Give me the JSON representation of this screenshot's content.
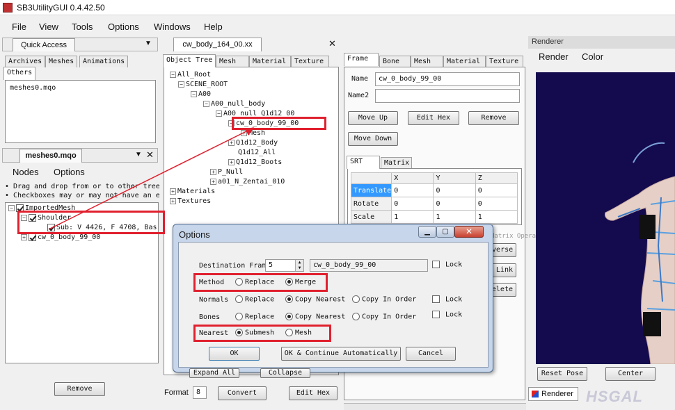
{
  "title_bar": {
    "title": "SB3UtilityGUI 0.4.42.50"
  },
  "menu": [
    "File",
    "View",
    "Tools",
    "Options",
    "Windows",
    "Help"
  ],
  "quick_access": {
    "title": "Quick Access",
    "tabs": [
      "Archives",
      "Meshes",
      "Animations",
      "Others"
    ],
    "items": [
      "meshes0.mqo"
    ]
  },
  "mqo_panel": {
    "title": "meshes0.mqo",
    "menu": [
      "Nodes",
      "Options"
    ],
    "hint1": "• Drag and drop from or to other tree",
    "hint2": "• Checkboxes may or may not have an e",
    "tree": [
      "ImportedMesh",
      "Shoulder",
      "Sub: V 4426, F 4708, Bas",
      "cw_0_body_99_00"
    ],
    "remove_label": "Remove"
  },
  "doc_tab": {
    "label": "cw_body_164_00.xx"
  },
  "object_tree": {
    "tabs": [
      "Object Tree",
      "Mesh",
      "Material",
      "Texture"
    ],
    "nodes": [
      "All_Root",
      "SCENE_ROOT",
      "A00",
      "A00_null_body",
      "A00_null_Q1d12_00",
      "cw_0_body_99_00",
      "Mesh",
      "Q1d12_Body",
      "Q1d12_All",
      "Q1d12_Boots",
      "P_Null",
      "a01_N_Zentai_010",
      "Materials",
      "Textures"
    ],
    "format_label": "Format",
    "format_value": "8",
    "convert_label": "Convert",
    "edit_hex_label": "Edit Hex",
    "hidden_btn1": "Expand All",
    "hidden_btn2": "Collapse"
  },
  "frame_panel": {
    "tabs": [
      "Frame",
      "Bone",
      "Mesh",
      "Material",
      "Texture"
    ],
    "name_label": "Name",
    "name_value": "cw_0_body_99_00",
    "name2_label": "Name2",
    "name2_value": "",
    "move_up": "Move Up",
    "edit_hex": "Edit Hex",
    "remove": "Remove",
    "move_down": "Move Down",
    "srt_tabs": [
      "SRT",
      "Matrix"
    ],
    "grid_headers": [
      "",
      "X",
      "Y",
      "Z"
    ],
    "grid_rows": [
      {
        "label": "Translate",
        "x": "0",
        "y": "0",
        "z": "0"
      },
      {
        "label": "Rotate",
        "x": "0",
        "y": "0",
        "z": "0"
      },
      {
        "label": "Scale",
        "x": "1",
        "y": "1",
        "z": "1"
      }
    ],
    "hidden_label": "Matrix Operations",
    "btn_reverse": "Reverse",
    "btn_link": "Link",
    "btn_delete": "Delete"
  },
  "renderer": {
    "title": "Renderer",
    "menu": [
      "Render",
      "Color"
    ],
    "reset_pose": "Reset Pose",
    "center": "Center",
    "tab_label": "Renderer",
    "watermark": "HSGAL"
  },
  "options_dialog": {
    "title": "Options",
    "dest_label": "Destination Fram",
    "dest_value": "5",
    "dest_name": "cw_0_body_99_00",
    "lock": "Lock",
    "method_label": "Method",
    "replace": "Replace",
    "merge": "Merge",
    "normals_label": "Normals",
    "copy_nearest": "Copy Nearest",
    "copy_in_order": "Copy In Order",
    "bones_label": "Bones",
    "nearest_label": "Nearest",
    "submesh": "Submesh",
    "mesh": "Mesh",
    "ok": "OK",
    "ok_continue": "OK & Continue Automatically",
    "cancel": "Cancel"
  },
  "colors": {
    "highlight": "#e0202e",
    "selection": "#3399ff",
    "viewport": "#140a4e"
  }
}
